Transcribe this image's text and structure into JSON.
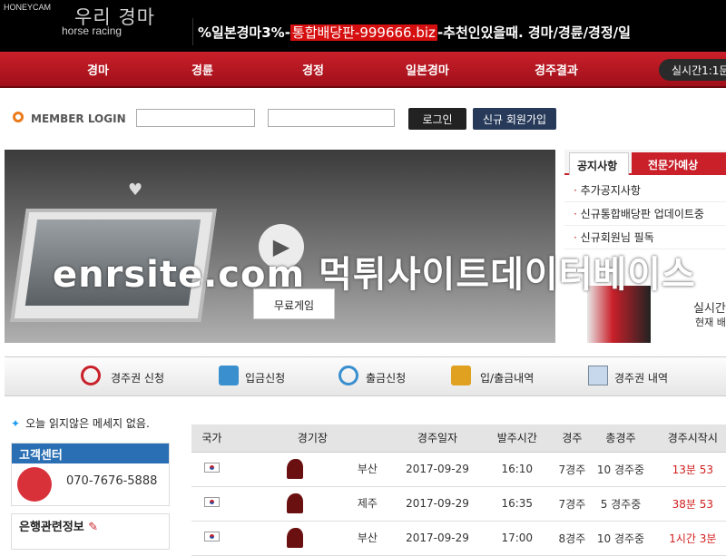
{
  "header": {
    "honeycam": "HONEYCAM",
    "logo_title": "우리 경마",
    "logo_subtitle": "horse racing",
    "marquee_prefix": "%일본경마3%-",
    "marquee_highlight": "통합배당판-999666.biz",
    "marquee_suffix": "-추천인있을때. 경마/경륜/경정/일"
  },
  "nav": {
    "items": [
      "경마",
      "경륜",
      "경정",
      "일본경마",
      "경주결과"
    ],
    "live_button": "실시간1:1문"
  },
  "member_login": {
    "title": "MEMBER LOGIN",
    "login_button": "로그인",
    "signup_button": "신규 회원가입",
    "id_value": "",
    "password_value": ""
  },
  "banner": {
    "free_game_label": "무료게임",
    "watermark": "enrsite.com 먹튀사이트데이터베이스"
  },
  "notice_panel": {
    "tab_active": "공지사항",
    "tab_inactive": "전문가예상",
    "items": [
      "추가공지사항",
      "신규통합배당판 업데이트중",
      "신규회원님 필독"
    ],
    "bottom_title": "실시간",
    "bottom_sub": "현재 배"
  },
  "toolbar": {
    "items": [
      "경주권 신청",
      "입금신청",
      "출금신청",
      "입/출금내역",
      "경주권 내역"
    ]
  },
  "left": {
    "unread_message": "오늘 읽지않은 메세지  없음.",
    "customer_center_title": "고객센터",
    "customer_center_phone": "070-7676-5888",
    "bank_info_title": "은행관련정보"
  },
  "race_table": {
    "headers": [
      "국가",
      "경기장",
      "경주일자",
      "발주시간",
      "경주",
      "총경주",
      "경주시작시"
    ],
    "rows": [
      {
        "venue": "부산",
        "date": "2017-09-29",
        "time": "16:10",
        "race": "7경주",
        "total": "10 경주중",
        "starts": "13분 53"
      },
      {
        "venue": "제주",
        "date": "2017-09-29",
        "time": "16:35",
        "race": "7경주",
        "total": "5 경주중",
        "starts": "38분 53"
      },
      {
        "venue": "부산",
        "date": "2017-09-29",
        "time": "17:00",
        "race": "8경주",
        "total": "10 경주중",
        "starts": "1시간 3분"
      }
    ]
  }
}
